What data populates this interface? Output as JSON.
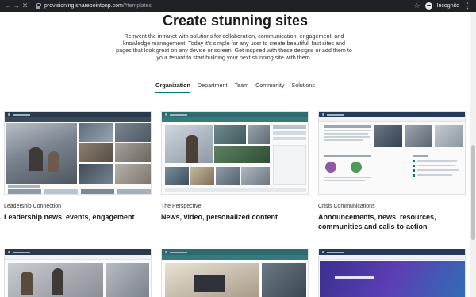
{
  "browser": {
    "url_host": "provisioning.sharepointpnp.com",
    "url_path": "/#templates",
    "incognito_label": "Incognito"
  },
  "hero": {
    "title": "Create stunning sites",
    "intro": "Reinvent the intranet with solutions for collaboration, communication, engagement, and knowledge management. Today it's simple for any user to create beautiful, fast sites and pages that look great on any device or screen. Get inspired with these designs or add them to your tenant to start building your next stunning site with them."
  },
  "tabs": [
    "Organization",
    "Department",
    "Team",
    "Community",
    "Solutions"
  ],
  "active_tab": "Organization",
  "templates": [
    {
      "category": "Leadership Connection",
      "title": "Leadership news, events, engagement"
    },
    {
      "category": "The Perspective",
      "title": "News, video, personalized content"
    },
    {
      "category": "Crisis Communications",
      "title": "Announcements, news, resources, communities and calls-to-action"
    }
  ],
  "icons": [
    "back-icon",
    "forward-icon",
    "close-icon",
    "lock-icon",
    "star-icon",
    "incognito-icon",
    "more-icon"
  ],
  "colors": {
    "accent": "#03787c",
    "chrome": "#202124"
  }
}
